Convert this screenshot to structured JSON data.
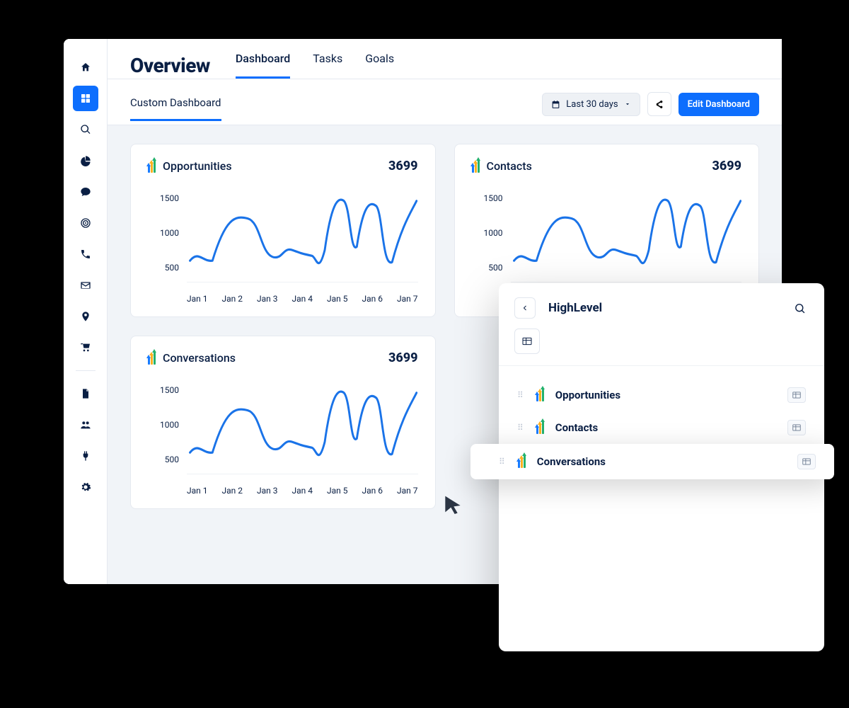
{
  "header": {
    "title": "Overview",
    "tabs": [
      "Dashboard",
      "Tasks",
      "Goals"
    ],
    "active_tab": 0
  },
  "subheader": {
    "tabs": [
      "Custom Dashboard"
    ],
    "date_range_label": "Last 30 days",
    "edit_button": "Edit Dashboard"
  },
  "sidebar": {
    "items": [
      {
        "name": "home-icon"
      },
      {
        "name": "grid-icon",
        "active": true
      },
      {
        "name": "search-icon"
      },
      {
        "name": "pie-chart-icon"
      },
      {
        "name": "chat-icon"
      },
      {
        "name": "target-icon"
      },
      {
        "name": "phone-icon"
      },
      {
        "name": "mail-icon"
      },
      {
        "name": "map-pin-icon"
      },
      {
        "name": "cart-icon"
      },
      {
        "divider": true
      },
      {
        "name": "file-icon"
      },
      {
        "name": "users-icon"
      },
      {
        "name": "plug-icon"
      },
      {
        "name": "gear-icon"
      }
    ]
  },
  "cards": [
    {
      "title": "Opportunities",
      "value": "3699"
    },
    {
      "title": "Contacts",
      "value": "3699"
    },
    {
      "title": "Conversations",
      "value": "3699"
    }
  ],
  "chart_data": {
    "type": "line",
    "categories": [
      "Jan 1",
      "Jan 2",
      "Jan 3",
      "Jan 4",
      "Jan 5",
      "Jan 6",
      "Jan 7"
    ],
    "y_ticks": [
      500,
      1000,
      1500
    ],
    "ylim": [
      400,
      1600
    ],
    "series": [
      {
        "name": "Opportunities",
        "values": [
          650,
          1200,
          750,
          750,
          1500,
          1400,
          1500
        ]
      },
      {
        "name": "Contacts",
        "values": [
          650,
          1200,
          750,
          750,
          1500,
          1400,
          1500
        ]
      },
      {
        "name": "Conversations",
        "values": [
          650,
          1200,
          750,
          750,
          1500,
          1400,
          1500
        ]
      }
    ],
    "note": "All three widgets display the same sample line shape in the source image."
  },
  "picker": {
    "title": "HighLevel",
    "items": [
      {
        "label": "Opportunities"
      },
      {
        "label": "Contacts"
      },
      {
        "label": "Conversations",
        "dragging": true
      }
    ]
  }
}
